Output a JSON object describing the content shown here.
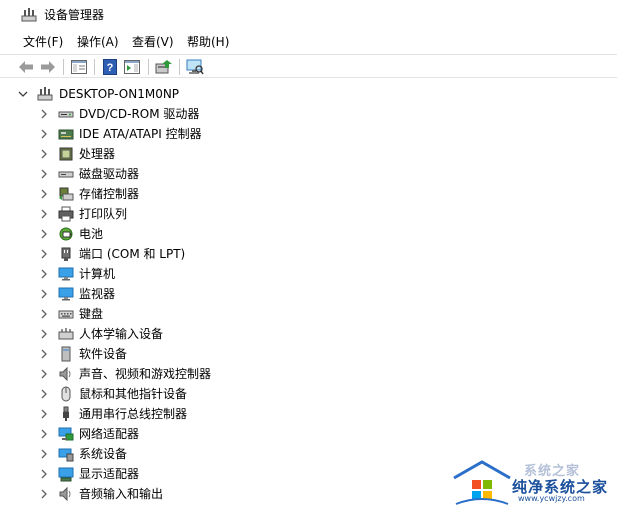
{
  "window": {
    "title": "设备管理器",
    "icon": "device-manager-icon"
  },
  "menu": [
    {
      "label": "文件(F)"
    },
    {
      "label": "操作(A)"
    },
    {
      "label": "查看(V)"
    },
    {
      "label": "帮助(H)"
    }
  ],
  "toolbar": [
    {
      "icon": "back-arrow-icon"
    },
    {
      "icon": "forward-arrow-icon"
    },
    {
      "icon": "show-hide-console-tree-icon"
    },
    {
      "icon": "help-icon"
    },
    {
      "icon": "action-pane-icon"
    },
    {
      "icon": "update-driver-icon"
    },
    {
      "icon": "scan-hardware-icon"
    }
  ],
  "tree": {
    "root": {
      "label": "DESKTOP-ON1M0NP",
      "expanded": true
    },
    "categories": [
      {
        "label": "DVD/CD-ROM 驱动器",
        "icon": "dvd-drive-icon"
      },
      {
        "label": "IDE ATA/ATAPI 控制器",
        "icon": "ide-controller-icon"
      },
      {
        "label": "处理器",
        "icon": "processor-icon"
      },
      {
        "label": "磁盘驱动器",
        "icon": "disk-drive-icon"
      },
      {
        "label": "存储控制器",
        "icon": "storage-controller-icon"
      },
      {
        "label": "打印队列",
        "icon": "printer-icon"
      },
      {
        "label": "电池",
        "icon": "battery-icon"
      },
      {
        "label": "端口 (COM 和 LPT)",
        "icon": "port-icon"
      },
      {
        "label": "计算机",
        "icon": "computer-icon"
      },
      {
        "label": "监视器",
        "icon": "monitor-icon"
      },
      {
        "label": "键盘",
        "icon": "keyboard-icon"
      },
      {
        "label": "人体学输入设备",
        "icon": "hid-icon"
      },
      {
        "label": "软件设备",
        "icon": "software-device-icon"
      },
      {
        "label": "声音、视频和游戏控制器",
        "icon": "speaker-icon"
      },
      {
        "label": "鼠标和其他指针设备",
        "icon": "mouse-icon"
      },
      {
        "label": "通用串行总线控制器",
        "icon": "usb-icon"
      },
      {
        "label": "网络适配器",
        "icon": "network-adapter-icon"
      },
      {
        "label": "系统设备",
        "icon": "system-device-icon"
      },
      {
        "label": "显示适配器",
        "icon": "display-adapter-icon"
      },
      {
        "label": "音频输入和输出",
        "icon": "audio-io-icon"
      }
    ]
  },
  "watermark": {
    "top_text": "系统之家",
    "name": "纯净系统之家",
    "url": "www.ycwjzy.com"
  },
  "colors": {
    "accent_blue": "#1a6fd1",
    "monitor_blue": "#3aa0e8",
    "chevron_gray": "#606060",
    "watermark_blue": "#1a4f9c"
  }
}
